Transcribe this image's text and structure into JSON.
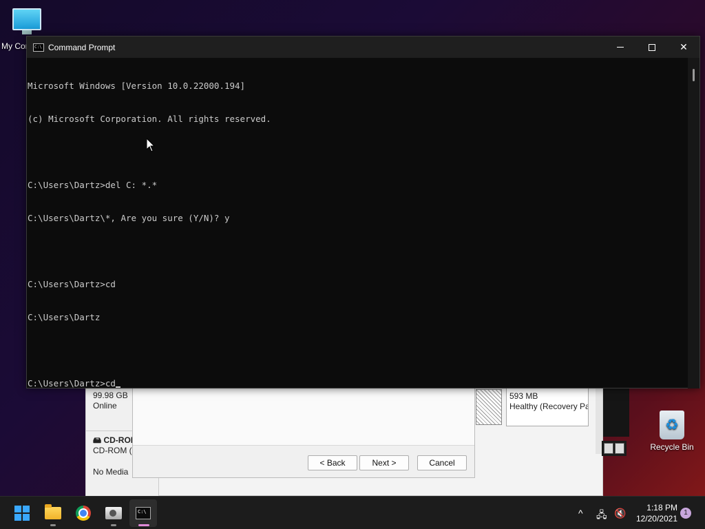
{
  "desktop": {
    "icons": [
      {
        "label": "My Computer"
      },
      {
        "label": "Recycle Bin"
      }
    ]
  },
  "disk_management": {
    "disk0": {
      "size": "99.98 GB",
      "status": "Online"
    },
    "cdrom": {
      "title": "CD-ROM",
      "line": "CD-ROM (D:)",
      "media": "No Media"
    },
    "recovery_partition": {
      "size": "593 MB",
      "status": "Healthy (Recovery Partition)"
    }
  },
  "wizard": {
    "back_label": "< Back",
    "next_label": "Next >",
    "cancel_label": "Cancel"
  },
  "cmd": {
    "title": "Command Prompt",
    "icon_text": "C:\\",
    "controls": {
      "close": "✕"
    },
    "lines": [
      "Microsoft Windows [Version 10.0.22000.194]",
      "(c) Microsoft Corporation. All rights reserved.",
      "",
      "C:\\Users\\Dartz>del C: *.*",
      "C:\\Users\\Dartz\\*, Are you sure (Y/N)? y",
      "",
      "C:\\Users\\Dartz>cd",
      "C:\\Users\\Dartz",
      "",
      "C:\\Users\\Dartz>cd"
    ]
  },
  "taskbar": {
    "apps": [
      {
        "name": "start-icon"
      },
      {
        "name": "file-explorer-icon"
      },
      {
        "name": "chrome-icon"
      },
      {
        "name": "disk-management-icon"
      },
      {
        "name": "command-prompt-icon"
      }
    ],
    "tray": {
      "chevron": "^",
      "time": "1:18 PM",
      "date": "12/20/2021",
      "notifications": "1"
    }
  },
  "colors": {
    "console_bg": "#0c0c0c",
    "console_text": "#cccccc",
    "titlebar": "#1f1f1f",
    "taskbar": "#1c1c1c",
    "accent_windows": "#3aa8ff"
  }
}
